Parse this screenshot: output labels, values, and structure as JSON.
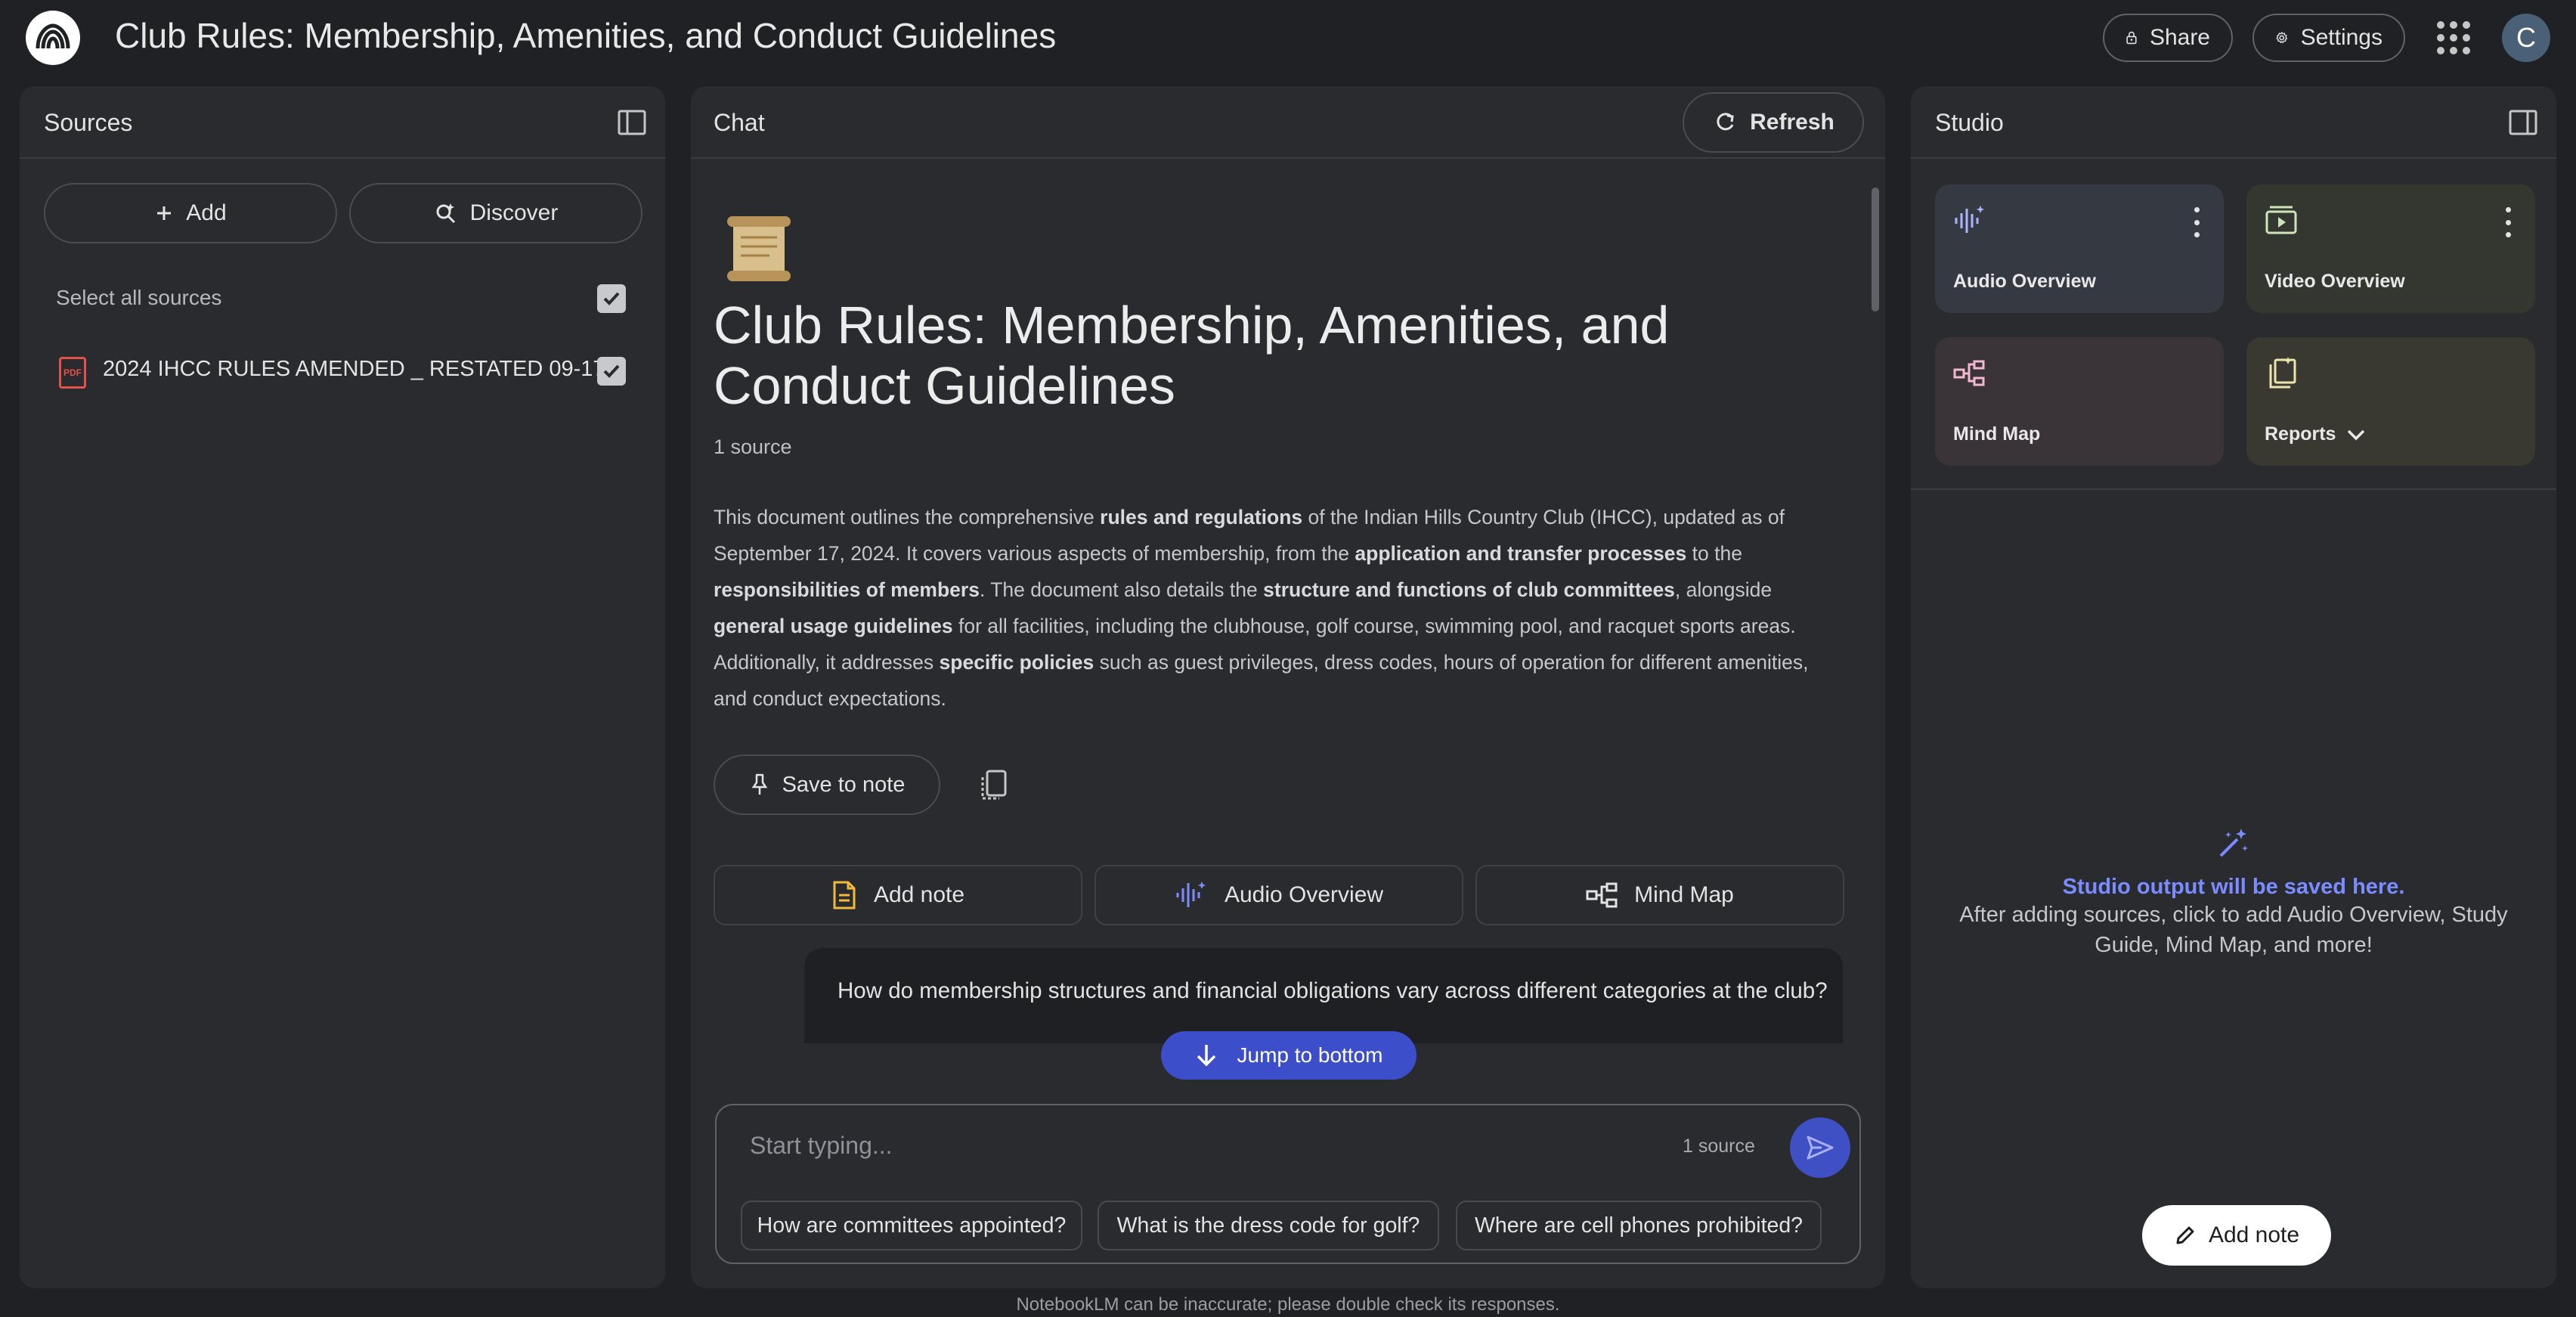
{
  "header": {
    "title": "Club Rules: Membership, Amenities, and Conduct Guidelines",
    "share_label": "Share",
    "settings_label": "Settings",
    "avatar_initial": "C"
  },
  "sources": {
    "title": "Sources",
    "add_label": "Add",
    "discover_label": "Discover",
    "select_all_label": "Select all sources",
    "items": [
      {
        "name": "2024 IHCC RULES AMENDED _ RESTATED 09-17...",
        "type_badge": "PDF",
        "checked": true
      }
    ]
  },
  "chat": {
    "title": "Chat",
    "refresh_label": "Refresh",
    "emoji": "📜",
    "notebook_title": "Club Rules: Membership, Amenities, and Conduct Guidelines",
    "source_count": "1 source",
    "summary": [
      {
        "text": "This document outlines the comprehensive ",
        "bold": false
      },
      {
        "text": "rules and regulations",
        "bold": true
      },
      {
        "text": " of the Indian Hills Country Club (IHCC), updated as of September 17, 2024. It covers various aspects of membership, from the ",
        "bold": false
      },
      {
        "text": "application and transfer processes",
        "bold": true
      },
      {
        "text": " to the ",
        "bold": false
      },
      {
        "text": "responsibilities of members",
        "bold": true
      },
      {
        "text": ". The document also details the ",
        "bold": false
      },
      {
        "text": "structure and functions of club committees",
        "bold": true
      },
      {
        "text": ", alongside ",
        "bold": false
      },
      {
        "text": "general usage guidelines",
        "bold": true
      },
      {
        "text": " for all facilities, including the clubhouse, golf course, swimming pool, and racquet sports areas. Additionally, it addresses ",
        "bold": false
      },
      {
        "text": "specific policies",
        "bold": true
      },
      {
        "text": " such as guest privileges, dress codes, hours of operation for different amenities, and conduct expectations.",
        "bold": false
      }
    ],
    "save_to_note_label": "Save to note",
    "actions": {
      "add_note": "Add note",
      "audio_overview": "Audio Overview",
      "mind_map": "Mind Map"
    },
    "suggested_question": "How do membership structures and financial obligations vary across different categories at the club?",
    "jump_to_bottom_label": "Jump to bottom",
    "composer": {
      "placeholder": "Start typing...",
      "source_count": "1 source"
    },
    "chips": [
      "How are committees appointed?",
      "What is the dress code for golf?",
      "Where are cell phones prohibited?"
    ]
  },
  "studio": {
    "title": "Studio",
    "tiles": {
      "audio_overview": "Audio Overview",
      "video_overview": "Video Overview",
      "mind_map": "Mind Map",
      "reports": "Reports"
    },
    "empty_title": "Studio output will be saved here.",
    "empty_desc": "After adding sources, click to add Audio Overview, Study Guide, Mind Map, and more!",
    "add_note_label": "Add note"
  },
  "footer": {
    "disclaimer": "NotebookLM can be inaccurate; please double check its responses."
  },
  "colors": {
    "background": "#202124",
    "panel": "#2a2b2f",
    "accent_blue": "#3d4ecb",
    "studio_link": "#7a8cff",
    "pdf_red": "#e2524a"
  },
  "icons": {
    "logo": "notebooklm-logo",
    "share": "lock-icon",
    "settings": "gear-icon",
    "apps": "apps-grid-icon",
    "refresh": "refresh-icon",
    "add_note": "note-icon",
    "audio": "audio-wave-icon",
    "mind_map": "mind-map-icon",
    "video": "video-icon",
    "reports": "reports-icon",
    "send": "send-icon"
  }
}
